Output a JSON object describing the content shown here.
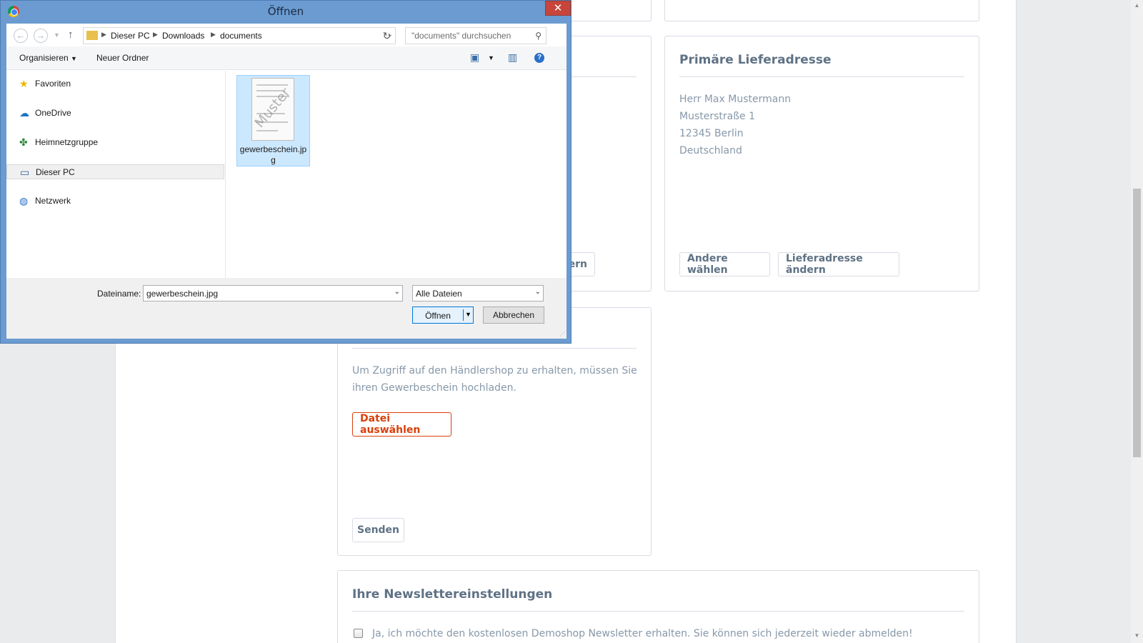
{
  "page": {
    "shipping": {
      "title": "Primäre Lieferadresse",
      "address": [
        "Herr Max Mustermann",
        "Musterstraße 1",
        "12345 Berlin",
        "Deutschland"
      ],
      "choose_other_label": "Andere wählen",
      "change_label": "Lieferadresse ändern"
    },
    "hidden_button_fragment": "ern",
    "trade_license": {
      "description": "Um Zugriff auf den Händlershop zu erhalten, müssen Sie ihren Gewerbeschein hochladen.",
      "choose_file_label": "Datei auswählen",
      "send_label": "Senden"
    },
    "newsletter": {
      "title": "Ihre Newslettereinstellungen",
      "checkbox_label": "Ja, ich möchte den kostenlosen Demoshop Newsletter erhalten. Sie können sich jederzeit wieder abmelden!",
      "checked": false
    }
  },
  "dialog": {
    "title": "Öffnen",
    "close_symbol": "✕",
    "breadcrumb": [
      "Dieser PC",
      "Downloads",
      "documents"
    ],
    "search_placeholder": "\"documents\" durchsuchen",
    "toolbar": {
      "organize_label": "Organisieren",
      "new_folder_label": "Neuer Ordner"
    },
    "nav_items": [
      {
        "label": "Favoriten",
        "icon": "star-icon"
      },
      {
        "label": "OneDrive",
        "icon": "cloud-icon"
      },
      {
        "label": "Heimnetzgruppe",
        "icon": "homegroup-icon"
      },
      {
        "label": "Dieser PC",
        "icon": "computer-icon",
        "selected": true
      },
      {
        "label": "Netzwerk",
        "icon": "network-icon"
      }
    ],
    "files": [
      {
        "name": "gewerbeschein.jpg",
        "thumbnail_text": "Muster",
        "selected": true
      }
    ],
    "filename_label": "Dateiname:",
    "filename_value": "gewerbeschein.jpg",
    "filetype_value": "Alle Dateien",
    "open_label": "Öffnen",
    "cancel_label": "Abbrechen"
  }
}
